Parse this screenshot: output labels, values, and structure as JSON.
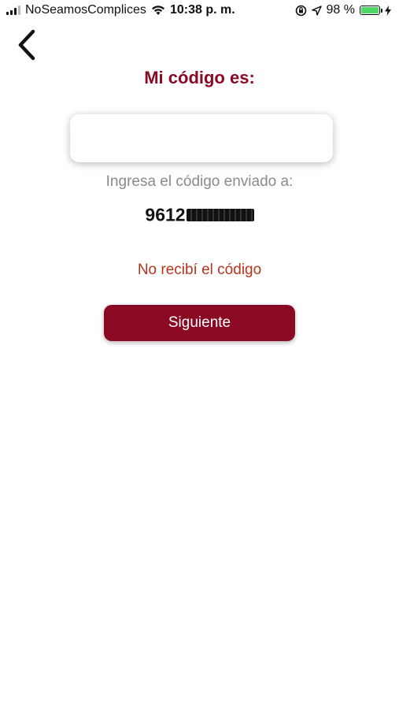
{
  "status_bar": {
    "carrier": "NoSeamosComplices",
    "time": "10:38 p. m.",
    "battery_percent": "98 %",
    "battery_level": 0.98,
    "icons": [
      "signal-icon",
      "wifi-icon",
      "screen-rotation-lock-icon",
      "location-arrow-icon",
      "battery-icon",
      "charging-bolt-icon"
    ]
  },
  "nav": {
    "back_icon": "chevron-left-icon"
  },
  "verification": {
    "title": "Mi código es:",
    "code_value": "",
    "instructions": "Ingresa el código enviado a:",
    "phone_prefix": "9612",
    "phone_redacted": true,
    "resend_link": "No recibí el código",
    "next_button": "Siguiente"
  },
  "colors": {
    "accent": "#8b0a23",
    "link": "#b5341d",
    "muted_text": "#8a8a8a",
    "battery_green": "#4cd964"
  }
}
